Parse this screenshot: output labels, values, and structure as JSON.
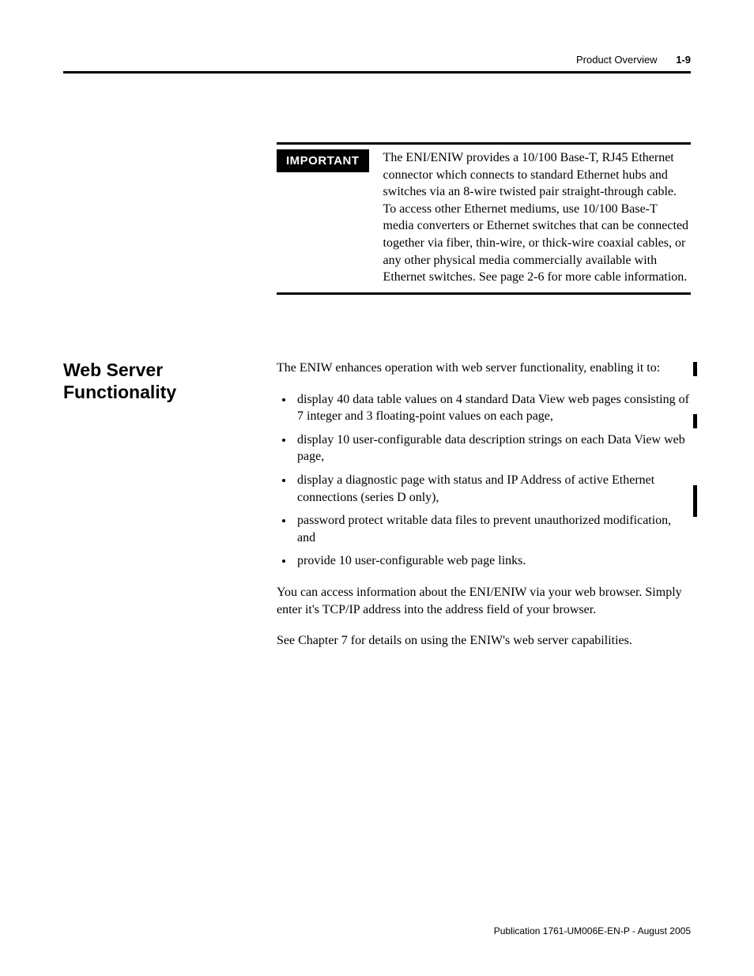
{
  "header": {
    "section": "Product Overview",
    "page": "1-9"
  },
  "important": {
    "label": "IMPORTANT",
    "text": "The ENI/ENIW provides a 10/100 Base-T, RJ45 Ethernet connector which connects to standard Ethernet hubs and switches via an 8-wire twisted pair straight-through cable. To access other Ethernet mediums, use 10/100 Base-T media converters or Ethernet switches that can be connected together via fiber, thin-wire, or thick-wire coaxial cables, or any other physical media commercially available with Ethernet switches. See page 2-6 for more cable information."
  },
  "section": {
    "heading": "Web Server Functionality",
    "intro": "The ENIW enhances operation with web server functionality, enabling it to:",
    "bullets": [
      "display 40 data table values on 4 standard Data View web pages consisting of 7 integer and 3 floating-point values on each page,",
      "display 10 user-configurable data description strings on each Data View web page,",
      "display a diagnostic page with status and IP Address of active Ethernet connections (series D only),",
      "password protect writable data files to prevent unauthorized modification, and",
      "provide 10 user-configurable web page links."
    ],
    "para1": "You can access information about the ENI/ENIW via your web browser. Simply enter it's TCP/IP address into the address field of your browser.",
    "para2": "See Chapter 7 for details on using the ENIW's web server capabilities."
  },
  "footer": "Publication 1761-UM006E-EN-P - August 2005"
}
